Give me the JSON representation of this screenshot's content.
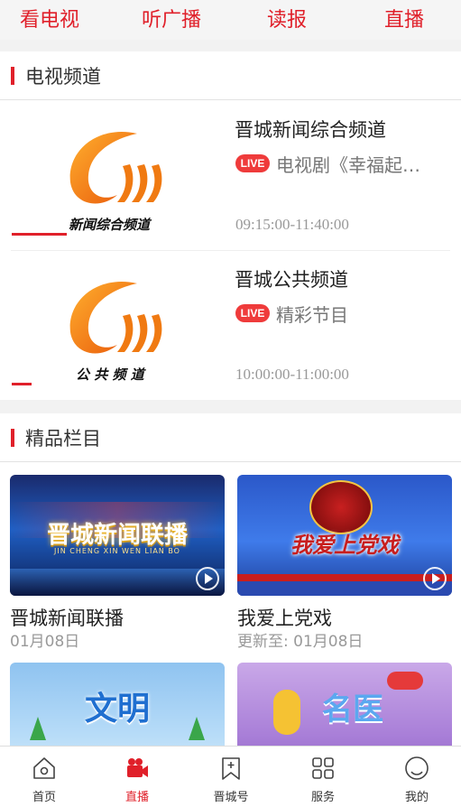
{
  "top_tabs": [
    "看电视",
    "听广播",
    "读报",
    "直播"
  ],
  "tv_section": {
    "title": "电视频道",
    "channels": [
      {
        "logo_text": "新闻综合频道",
        "name": "晋城新闻综合频道",
        "live_label": "LIVE",
        "program": "电视剧《幸福起…",
        "time": "09:15:00-11:40:00"
      },
      {
        "logo_text": "公 共 频 道",
        "name": "晋城公共频道",
        "live_label": "LIVE",
        "program": "精彩节目",
        "time": "10:00:00-11:00:00"
      }
    ]
  },
  "featured_section": {
    "title": "精品栏目",
    "cards": [
      {
        "title": "晋城新闻联播",
        "date": "01月08日",
        "thumb_text": "晋城新闻联播",
        "thumb_sub": "JIN CHENG XIN WEN LIAN BO"
      },
      {
        "title": "我爱上党戏",
        "date": "更新至:   01月08日",
        "thumb_text": "我爱上党戏"
      },
      {
        "thumb_text": "文明"
      },
      {
        "thumb_text": "名医"
      }
    ]
  },
  "bottom_nav": [
    {
      "label": "首页",
      "icon": "home-icon"
    },
    {
      "label": "直播",
      "icon": "video-camera-icon",
      "active": true
    },
    {
      "label": "晋城号",
      "icon": "bookmark-plus-icon"
    },
    {
      "label": "服务",
      "icon": "grid-icon"
    },
    {
      "label": "我的",
      "icon": "profile-icon"
    }
  ],
  "colors": {
    "accent": "#e0202a",
    "live_badge": "#ef3b3b"
  }
}
